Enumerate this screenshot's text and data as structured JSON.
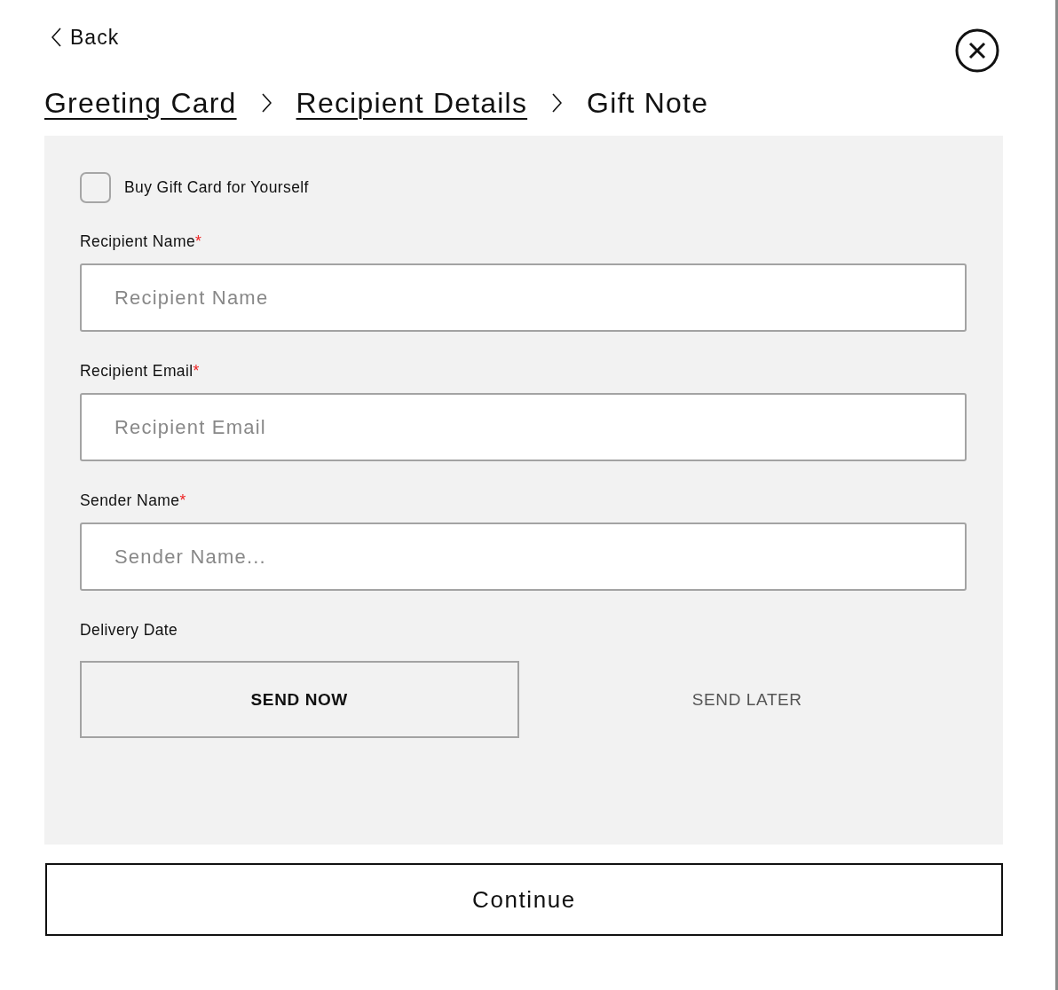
{
  "back": {
    "label": "Back"
  },
  "breadcrumb": [
    {
      "label": "Greeting Card",
      "selected": false
    },
    {
      "label": "Recipient Details",
      "selected": false
    },
    {
      "label": "Gift Note",
      "selected": true
    }
  ],
  "self_purchase": {
    "label": "Buy Gift Card for Yourself",
    "checked": false
  },
  "fields": [
    {
      "label": "Recipient Name",
      "required_mark": "*",
      "placeholder": "Recipient Name"
    },
    {
      "label": "Recipient Email",
      "required_mark": "*",
      "placeholder": "Recipient Email"
    },
    {
      "label": "Sender Name",
      "required_mark": "*",
      "placeholder": "Sender Name..."
    }
  ],
  "delivery_date": {
    "label": "Delivery Date",
    "options": [
      {
        "label": "SEND NOW",
        "selected": true
      },
      {
        "label": "SEND LATER",
        "selected": false
      }
    ]
  },
  "continue_button": {
    "label": "Continue"
  }
}
